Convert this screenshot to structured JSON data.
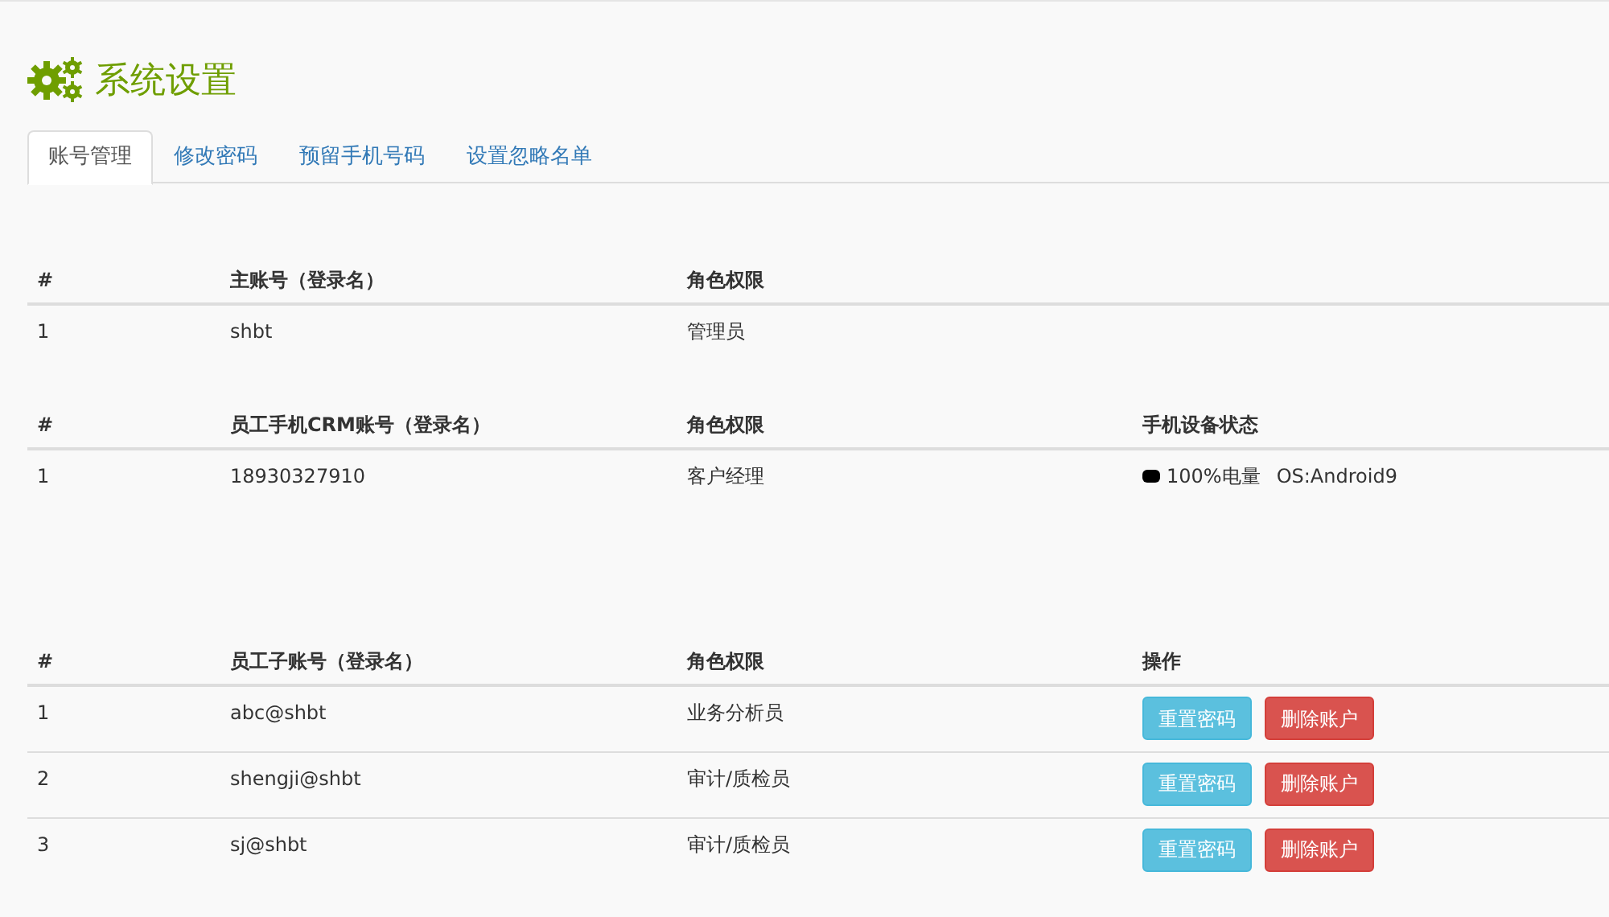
{
  "title": "系统设置",
  "tabs": [
    {
      "label": "账号管理",
      "selected": true
    },
    {
      "label": "修改密码",
      "selected": false
    },
    {
      "label": "预留手机号码",
      "selected": false
    },
    {
      "label": "设置忽略名单",
      "selected": false
    }
  ],
  "tables": [
    {
      "columns": [
        "#",
        "主账号（登录名）",
        "角色权限"
      ],
      "rows": [
        {
          "cells": [
            "1",
            "shbt",
            "管理员"
          ]
        }
      ]
    },
    {
      "columns": [
        "#",
        "员工手机CRM账号（登录名）",
        "角色权限",
        "手机设备状态"
      ],
      "rows": [
        {
          "cells": [
            "1",
            "18930327910",
            "客户经理"
          ],
          "device": {
            "battery": "100%电量",
            "os": "OS:Android9"
          }
        }
      ]
    },
    {
      "columns": [
        "#",
        "员工子账号（登录名）",
        "角色权限",
        "操作"
      ],
      "rows": [
        {
          "cells": [
            "1",
            "abc@shbt",
            "业务分析员"
          ],
          "actions": [
            {
              "label": "重置密码",
              "kind": "info"
            },
            {
              "label": "删除账户",
              "kind": "danger"
            }
          ]
        },
        {
          "cells": [
            "2",
            "shengji@shbt",
            "审计/质检员"
          ],
          "actions": [
            {
              "label": "重置密码",
              "kind": "info"
            },
            {
              "label": "删除账户",
              "kind": "danger"
            }
          ]
        },
        {
          "cells": [
            "3",
            "sj@shbt",
            "审计/质检员"
          ],
          "actions": [
            {
              "label": "重置密码",
              "kind": "info"
            },
            {
              "label": "删除账户",
              "kind": "danger"
            }
          ]
        }
      ]
    }
  ]
}
